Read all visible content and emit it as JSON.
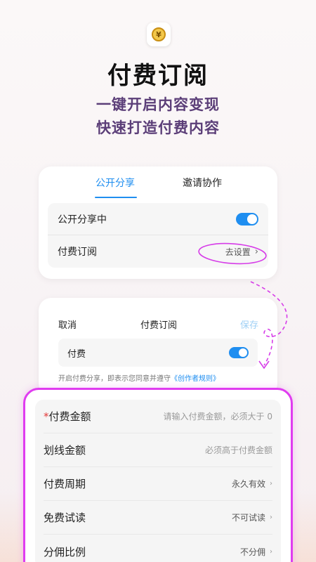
{
  "header": {
    "app_icon": "coin-yen-icon",
    "coin_glyph": "¥",
    "title": "付费订阅",
    "subtitle_line1": "一键开启内容变现",
    "subtitle_line2": "快速打造付费内容"
  },
  "share_card": {
    "tabs": [
      {
        "label": "公开分享",
        "active": true
      },
      {
        "label": "邀请协作",
        "active": false
      }
    ],
    "rows": {
      "public_share_label": "公开分享中",
      "public_share_on": true,
      "paid_sub_label": "付费订阅",
      "paid_sub_action": "去设置",
      "chevron": "›"
    }
  },
  "paid_card": {
    "cancel": "取消",
    "title": "付费订阅",
    "save": "保存",
    "pay_label": "付费",
    "pay_on": true,
    "notice_prefix": "开启付费分享，即表示您同意并遵守",
    "notice_link": "《创作者规则》"
  },
  "panel": {
    "rows": [
      {
        "required_mark": "*",
        "label": "付费金额",
        "value": "请输入付费金额，必须大于 0"
      },
      {
        "label": "划线金额",
        "value": "必须高于付费金额"
      },
      {
        "label": "付费周期",
        "value": "永久有效",
        "chevron": "›"
      },
      {
        "label": "免费试读",
        "value": "不可试读",
        "chevron": "›"
      },
      {
        "label": "分佣比例",
        "value": "不分佣",
        "chevron": "›"
      }
    ]
  },
  "colors": {
    "accent_blue": "#1f8ef0",
    "highlight_magenta": "#e03cf0",
    "subtitle_purple": "#5b3e78"
  }
}
